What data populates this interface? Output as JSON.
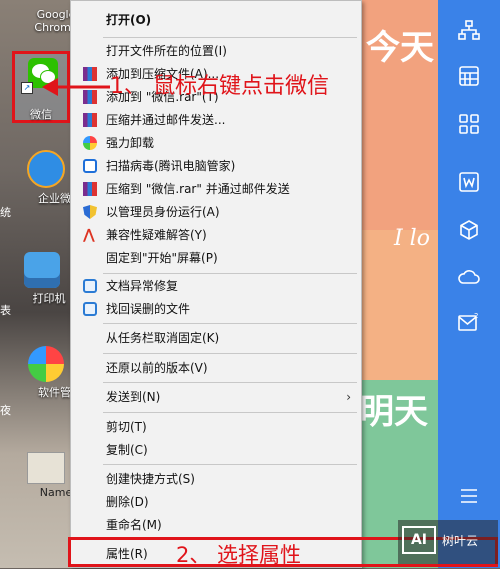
{
  "desktop": {
    "icons": [
      {
        "label": "Google Chrome",
        "icon": "chrome-icon"
      },
      {
        "label": "微信",
        "icon": "wechat-icon"
      },
      {
        "label": "企业微信",
        "icon": "wecom-icon"
      },
      {
        "label": "打印机",
        "icon": "printer-icon"
      },
      {
        "label": "软件管理",
        "icon": "software-manager-icon"
      },
      {
        "label": "Name",
        "icon": "file-icon"
      }
    ],
    "left_edge_fragments": [
      "统",
      "表",
      "夜"
    ]
  },
  "wallpaper": {
    "texts": [
      "今天",
      "I lo",
      "明天"
    ]
  },
  "context_menu": {
    "items": [
      {
        "label": "打开(O)",
        "bold": true,
        "icon": ""
      },
      {
        "label": "打开文件所在的位置(I)",
        "icon": ""
      },
      {
        "label": "添加到压缩文件(A)...",
        "icon": "winrar-icon"
      },
      {
        "label": "添加到 \"微信.rar\"(T)",
        "icon": "winrar-icon"
      },
      {
        "label": "压缩并通过邮件发送...",
        "icon": "winrar-icon"
      },
      {
        "label": "强力卸载",
        "icon": "uninstall-icon"
      },
      {
        "label": "扫描病毒(腾讯电脑管家)",
        "icon": "antivirus-icon"
      },
      {
        "label": "压缩到 \"微信.rar\" 并通过邮件发送",
        "icon": "winrar-icon"
      },
      {
        "label": "以管理员身份运行(A)",
        "icon": "shield-icon"
      },
      {
        "label": "兼容性疑难解答(Y)",
        "icon": "compat-icon"
      },
      {
        "label": "固定到\"开始\"屏幕(P)",
        "icon": ""
      },
      {
        "label": "文档异常修复",
        "icon": "doc-repair-icon"
      },
      {
        "label": "找回误删的文件",
        "icon": "recover-icon"
      },
      {
        "label": "从任务栏取消固定(K)",
        "icon": ""
      },
      {
        "label": "还原以前的版本(V)",
        "icon": ""
      },
      {
        "label": "发送到(N)",
        "icon": "",
        "submenu": true
      },
      {
        "label": "剪切(T)",
        "icon": ""
      },
      {
        "label": "复制(C)",
        "icon": ""
      },
      {
        "label": "创建快捷方式(S)",
        "icon": ""
      },
      {
        "label": "删除(D)",
        "icon": ""
      },
      {
        "label": "重命名(M)",
        "icon": ""
      },
      {
        "label": "属性(R)",
        "icon": ""
      }
    ]
  },
  "annotations": {
    "step1": "1、 鼠标右键点击微信",
    "step2": "2、 选择属性",
    "step1_color": "#e0141a"
  },
  "watermark": {
    "logo": "AI",
    "text": "树叶云"
  },
  "sidebar": {
    "icons": [
      "org-chart-icon",
      "calculator-icon",
      "grid-apps-icon",
      "word-icon",
      "cube-icon",
      "cloud-icon",
      "mail-icon",
      "menu-icon"
    ],
    "color": "#3a82e8"
  },
  "submenu_glyph": "›"
}
